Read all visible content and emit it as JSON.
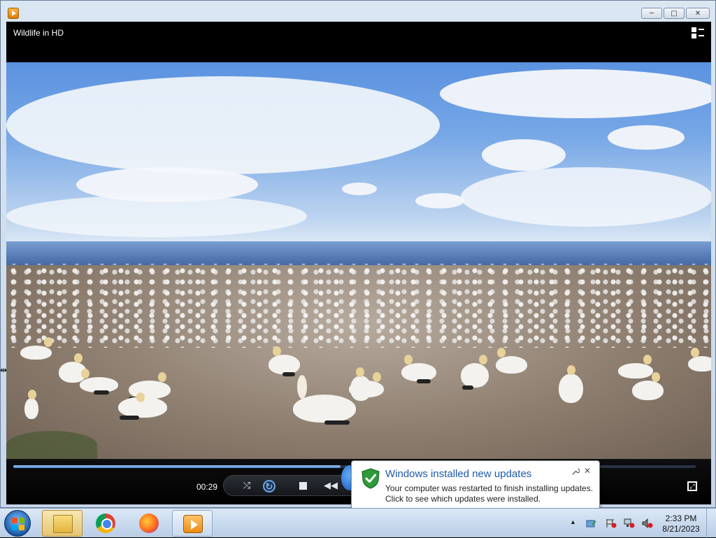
{
  "window": {
    "media_title": "Wildlife in HD",
    "buttons": {
      "minimize": "─",
      "maximize": "□",
      "close": "✕"
    }
  },
  "player": {
    "current_time": "00:29",
    "progress": 0.48,
    "controls": {
      "shuffle": "⤭",
      "repeat": "↻",
      "previous": "◀◀"
    },
    "fullscreen_icon": "⤢"
  },
  "notification": {
    "title": "Windows installed new updates",
    "line1": "Your computer was restarted to finish installing updates.",
    "line2": "Click to see which updates were installed.",
    "options_icon": "🔧",
    "close": "✕"
  },
  "taskbar": {
    "pinned": [
      {
        "name": "windows-explorer",
        "icon": "folder-icon",
        "state": "active"
      },
      {
        "name": "google-chrome",
        "icon": "chrome-icon",
        "state": "idle"
      },
      {
        "name": "firefox",
        "icon": "firefox-icon",
        "state": "idle"
      },
      {
        "name": "windows-media-player",
        "icon": "media-player-icon",
        "state": "running"
      }
    ],
    "tray_up": "▲",
    "clock_time": "2:33 PM",
    "clock_date": "8/21/2023"
  },
  "colors": {
    "notification_title": "#1e5aa8",
    "seek_fill": "#4f86d8",
    "taskbar": "#c6d8ee"
  }
}
